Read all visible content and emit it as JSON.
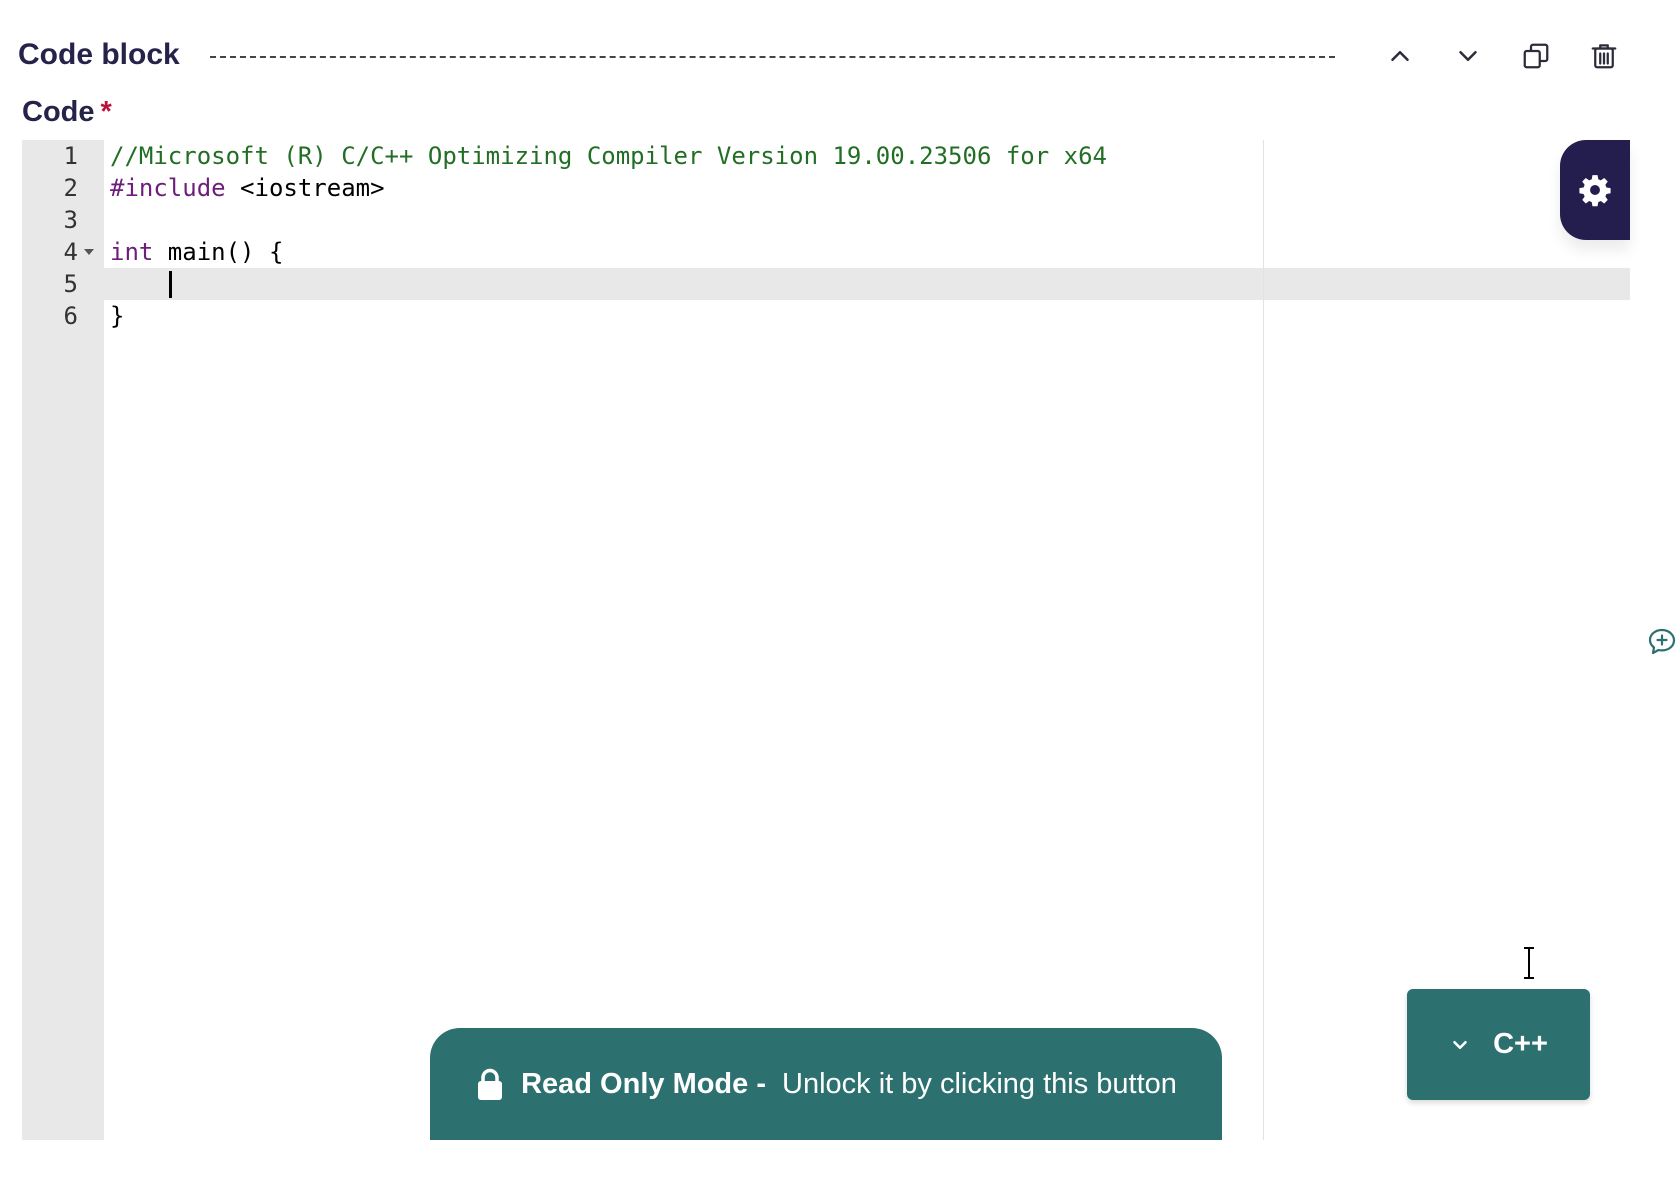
{
  "block": {
    "title": "Code block",
    "actions": {
      "move_up_icon": "chevron-up-icon",
      "move_down_icon": "chevron-down-icon",
      "duplicate_icon": "copy-icon",
      "delete_icon": "trash-icon"
    }
  },
  "field": {
    "label": "Code",
    "required_mark": "*"
  },
  "editor": {
    "lines": [
      {
        "number": "1",
        "segments": [
          {
            "text": "//Microsoft (R) C/C++ Optimizing Compiler Version 19.00.23506 for x64",
            "type": "comment"
          }
        ]
      },
      {
        "number": "2",
        "segments": [
          {
            "text": "#include",
            "type": "directive"
          },
          {
            "text": " <iostream>",
            "type": "plain"
          }
        ]
      },
      {
        "number": "3",
        "segments": []
      },
      {
        "number": "4",
        "foldable": true,
        "segments": [
          {
            "text": "int",
            "type": "keyword"
          },
          {
            "text": " main() {",
            "type": "plain"
          }
        ]
      },
      {
        "number": "5",
        "active": true,
        "segments": [
          {
            "text": "    ",
            "type": "plain"
          }
        ]
      },
      {
        "number": "6",
        "segments": [
          {
            "text": "}",
            "type": "plain"
          }
        ]
      }
    ],
    "settings_icon": "gear-icon"
  },
  "readonly_banner": {
    "title": "Read Only Mode -",
    "message": "Unlock it by clicking this button",
    "icon": "lock-icon"
  },
  "language_selector": {
    "value": "C++",
    "icon": "chevron-down-icon"
  },
  "comment_button": {
    "icon": "add-comment-icon"
  },
  "colors": {
    "accent": "#2d7070",
    "dark": "#241e4e",
    "title": "#25234a",
    "required": "#b8123c",
    "comment": "#236e25",
    "keyword": "#6d1e7a"
  }
}
